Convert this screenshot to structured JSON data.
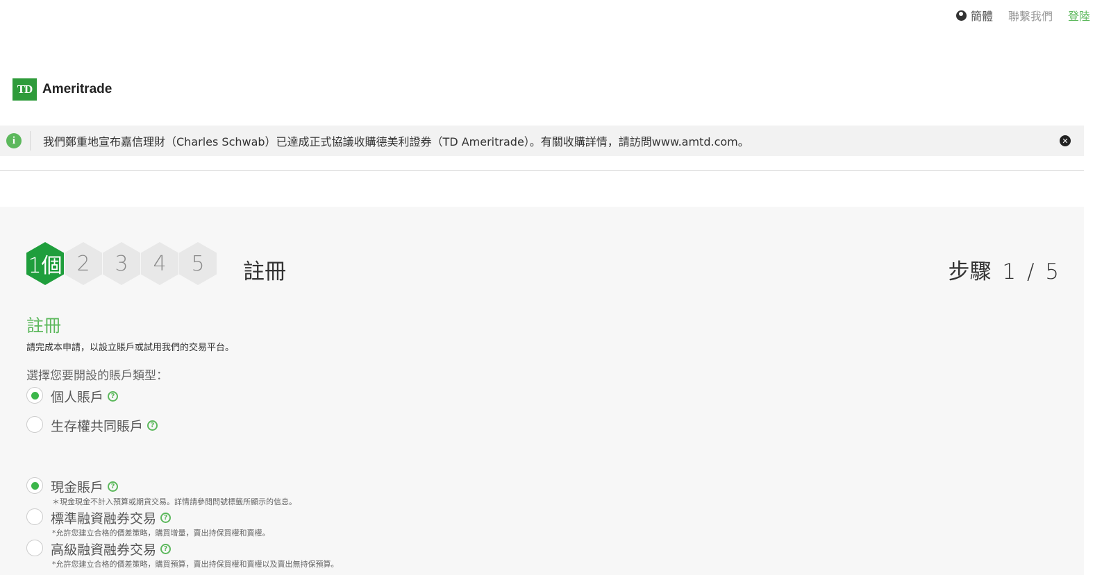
{
  "topbar": {
    "lang_label": "簡體",
    "contact_label": "聯繫我們",
    "login_label": "登陸"
  },
  "logo": {
    "mark": "TD",
    "brand": "Ameritrade"
  },
  "notice": {
    "message": "我們鄭重地宣布嘉信理財（Charles Schwab）已達成正式協議收購德美利證券（TD Ameritrade）。有關收購詳情，請訪問www.amtd.com。",
    "close_glyph": "✕"
  },
  "steps": {
    "items": [
      {
        "label": "1個",
        "active": true
      },
      {
        "label": "2",
        "active": false
      },
      {
        "label": "3",
        "active": false
      },
      {
        "label": "4",
        "active": false
      },
      {
        "label": "5",
        "active": false
      }
    ],
    "current_title": "註冊",
    "counter": "步驟 1 / 5"
  },
  "form": {
    "heading": "註冊",
    "description": "請完成本申請，以設立賬戶或試用我們的交易平台。",
    "prompt": "選擇您要開設的賬戶類型：",
    "ownership_options": [
      {
        "label": "個人賬戶",
        "checked": true
      },
      {
        "label": "生存權共同賬戶",
        "checked": false
      }
    ],
    "trading_options": [
      {
        "label": "現金賬戶",
        "note": "＊現金現金不計入預算或期貨交易。詳情請參閱問號標籤所顯示的信息。",
        "checked": true
      },
      {
        "label": "標準融資融券交易",
        "note": "*允許您建立合格的價差策略，購買增量，賣出持保買權和賣權。",
        "checked": false
      },
      {
        "label": "高級融資融券交易",
        "note": "*允許您建立合格的價差策略，購買預算，賣出持保買權和賣權以及賣出無持保預算。",
        "checked": false
      }
    ],
    "help_glyph": "?"
  },
  "colors": {
    "accent_green": "#5cb85c",
    "step_active": "#1f9e3c",
    "panel_bg": "#f7f7f7"
  }
}
